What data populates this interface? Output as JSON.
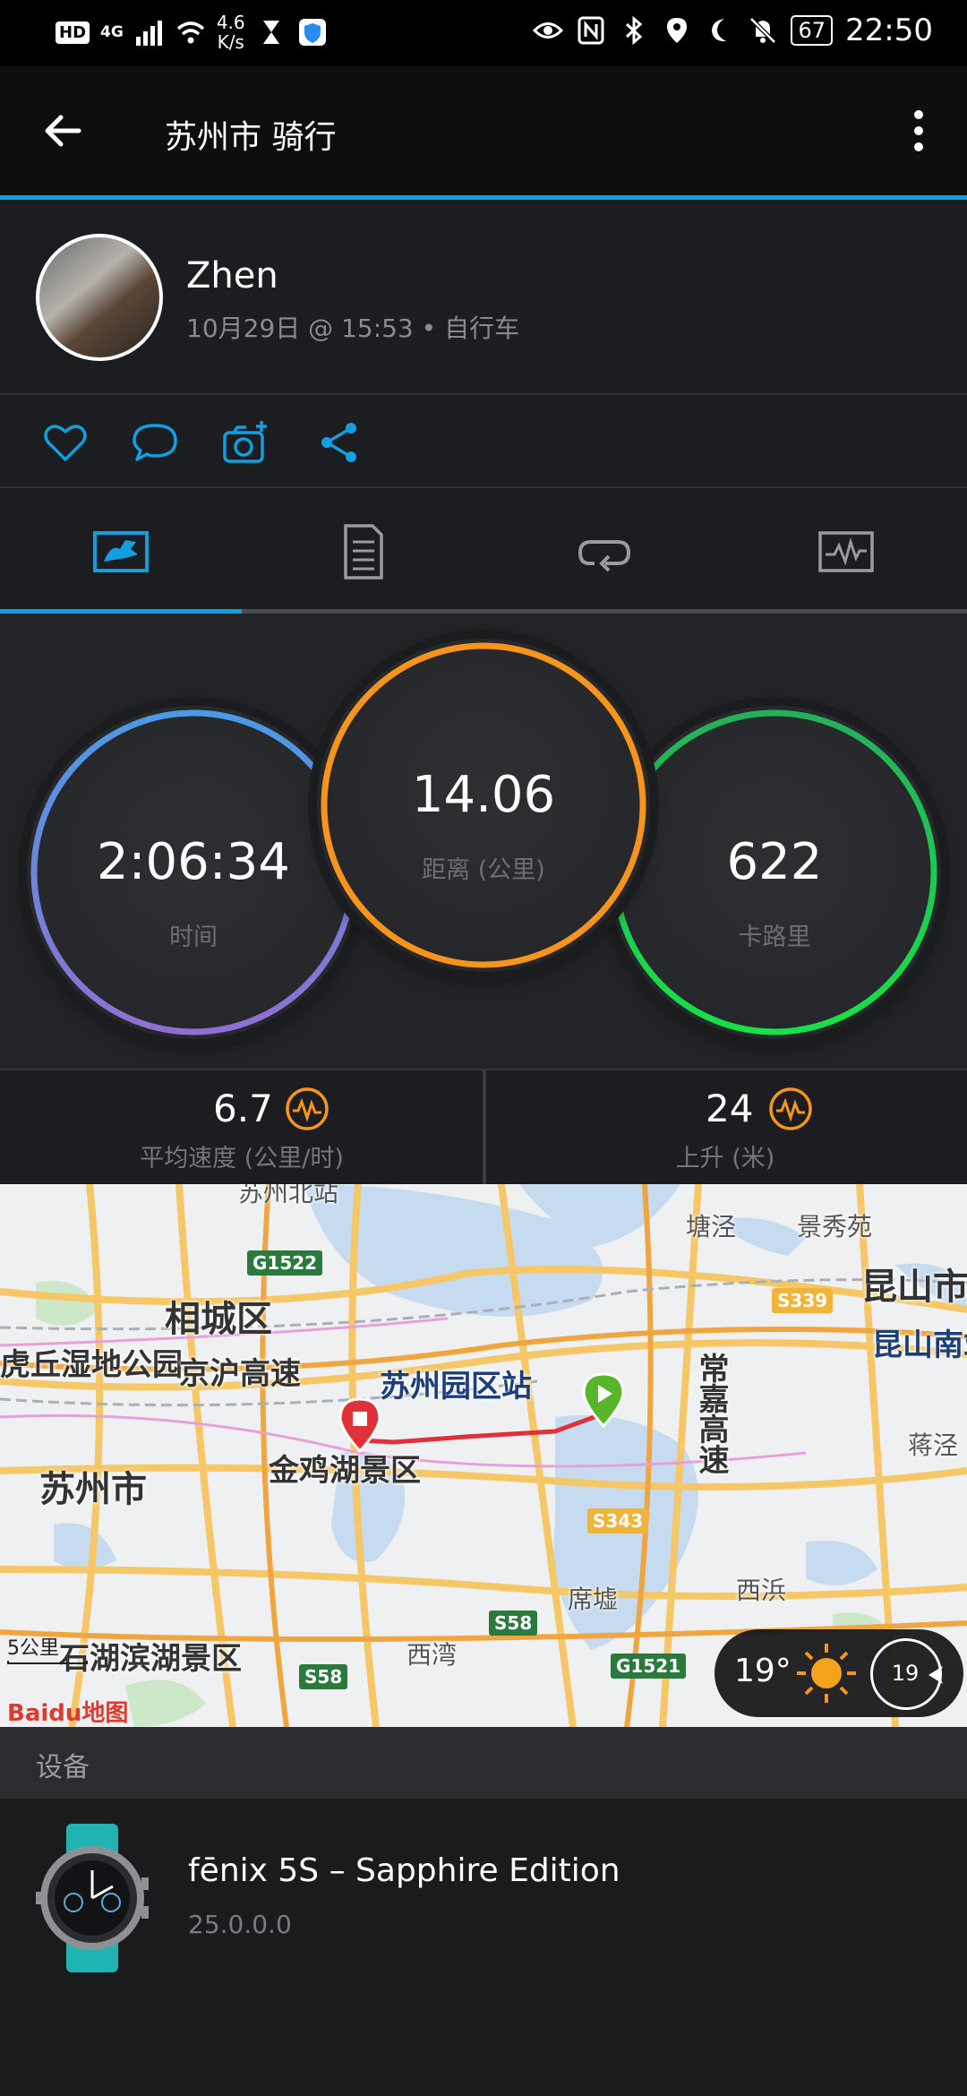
{
  "status_bar": {
    "hd": "HD",
    "network": "4G",
    "speed_value": "4.6",
    "speed_unit": "K/s",
    "battery": "67",
    "time": "22:50"
  },
  "header": {
    "title": "苏州市 骑行",
    "back_icon": "arrow-left-icon",
    "more_icon": "more-vertical-icon"
  },
  "profile": {
    "name": "Zhen",
    "meta": "10月29日 @ 15:53 • 自行车"
  },
  "actions": [
    {
      "icon": "heart-icon"
    },
    {
      "icon": "comment-icon"
    },
    {
      "icon": "add-photo-icon"
    },
    {
      "icon": "share-icon"
    }
  ],
  "tabs": [
    {
      "icon": "summary-chart-icon",
      "active": true
    },
    {
      "icon": "details-document-icon",
      "active": false
    },
    {
      "icon": "laps-loop-icon",
      "active": false
    },
    {
      "icon": "graphs-icon",
      "active": false
    }
  ],
  "stats": {
    "time": {
      "value": "2:06:34",
      "label": "时间"
    },
    "distance": {
      "value": "14.06",
      "label": "距离 (公里)"
    },
    "calories": {
      "value": "622",
      "label": "卡路里"
    }
  },
  "metrics": {
    "avg_speed": {
      "value": "6.7",
      "label": "平均速度 (公里/时)"
    },
    "ascent": {
      "value": "24",
      "label": "上升 (米)"
    }
  },
  "map": {
    "labels": {
      "xiangcheng": "相城区",
      "huqiu": "虎丘湿地公园",
      "jinghu": "京沪高速",
      "sip_station": "苏州园区站",
      "suzhou": "苏州市",
      "jinjihu": "金鸡湖景区",
      "changjia": "常嘉高速",
      "tangjing": "塘泾",
      "jingxiu": "景秀苑",
      "kunshan": "昆山市",
      "kunshan_south": "昆山南站",
      "jiangjing": "蒋泾",
      "xibin": "西浜",
      "xiwan": "西湾",
      "xiancheng": "席墟",
      "shihu": "石湖滨湖景区",
      "suzhou_north": "苏州北站"
    },
    "roads": {
      "g1522": "G1522",
      "s339": "S339",
      "s343": "S343",
      "s58a": "S58",
      "s58b": "S58",
      "g1521": "G1521"
    },
    "scale": "5公里",
    "brand": "Baidu地图",
    "weather": {
      "temperature": "19°",
      "wind_speed": "19"
    }
  },
  "devices": {
    "title": "设备",
    "name": "fēnix 5S – Sapphire Edition",
    "version": "25.0.0.0"
  },
  "colors": {
    "accent": "#119fdf",
    "time_ring": "#4a90e2",
    "distance_ring": "#f7941d",
    "calories_ring": "#22c35e",
    "metric_icon": "#f7941d",
    "route": "#e0303a"
  }
}
